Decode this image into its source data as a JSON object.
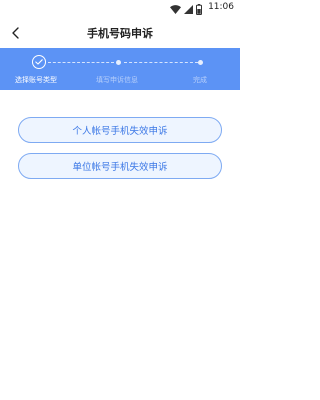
{
  "status_bar": {
    "time": "11:06",
    "icons": [
      "wifi-icon",
      "signal-icon",
      "battery-icon"
    ]
  },
  "header": {
    "title": "手机号码申诉",
    "back_icon": "chevron-left-icon"
  },
  "steps": [
    {
      "label": "选择账号类型",
      "state": "done"
    },
    {
      "label": "填写申诉信息",
      "state": "pending"
    },
    {
      "label": "完成",
      "state": "pending"
    }
  ],
  "options": [
    {
      "label": "个人帐号手机失效申诉"
    },
    {
      "label": "单位帐号手机失效申诉"
    }
  ],
  "colors": {
    "accent": "#5c93f5",
    "button_bg": "#eef5ff",
    "button_border": "#7eaaf2",
    "button_text": "#3c78e6"
  }
}
